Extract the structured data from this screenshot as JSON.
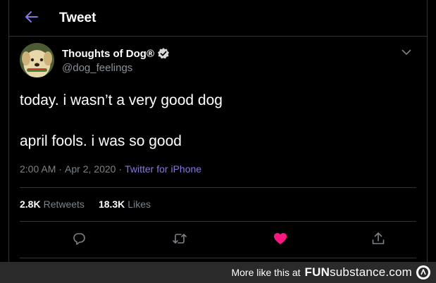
{
  "header": {
    "title": "Tweet"
  },
  "author": {
    "display_name": "Thoughts of Dog®",
    "handle": "@dog_feelings",
    "verified": true
  },
  "tweet": {
    "lines": [
      "today. i wasn’t a very good dog",
      "april fools. i was so good"
    ],
    "time": "2:00 AM",
    "separator": "·",
    "date": "Apr 2, 2020",
    "separator2": "·",
    "source": "Twitter for iPhone"
  },
  "stats": {
    "retweets_count": "2.8K",
    "retweets_label": "Retweets",
    "likes_count": "18.3K",
    "likes_label": "Likes"
  },
  "actions": {
    "reply_icon": "reply-icon",
    "retweet_icon": "retweet-icon",
    "like_icon": "heart-icon",
    "share_icon": "share-icon",
    "liked": true
  },
  "footer": {
    "text": "More like this at",
    "brand_bold": "FUN",
    "brand_rest": "substance.com"
  },
  "colors": {
    "accent": "#8b76e0",
    "heart": "#f91880",
    "background": "#000000"
  }
}
